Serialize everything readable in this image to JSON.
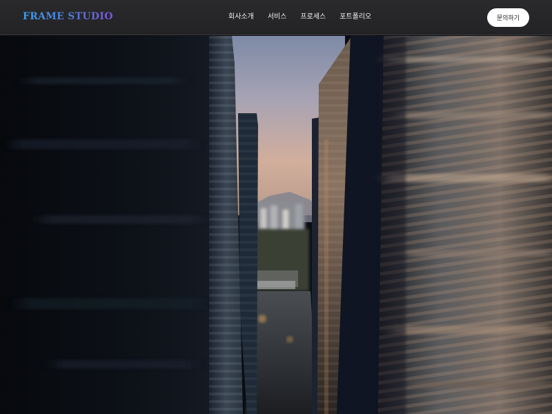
{
  "brand": {
    "logo_text": "FRAME STUDIO"
  },
  "nav": {
    "items": [
      {
        "label": "회사소개"
      },
      {
        "label": "서비스"
      },
      {
        "label": "프로세스"
      },
      {
        "label": "포트폴리오"
      }
    ]
  },
  "header": {
    "cta_label": "문의하기"
  },
  "hero": {
    "image_icon": "city-skyline-image"
  },
  "colors": {
    "navbar_bg": "#252527",
    "logo_gradient_start": "#3aa0f2",
    "logo_gradient_end": "#7b56d9",
    "cta_bg": "#ffffff",
    "hero_sky": "#c9a896"
  }
}
